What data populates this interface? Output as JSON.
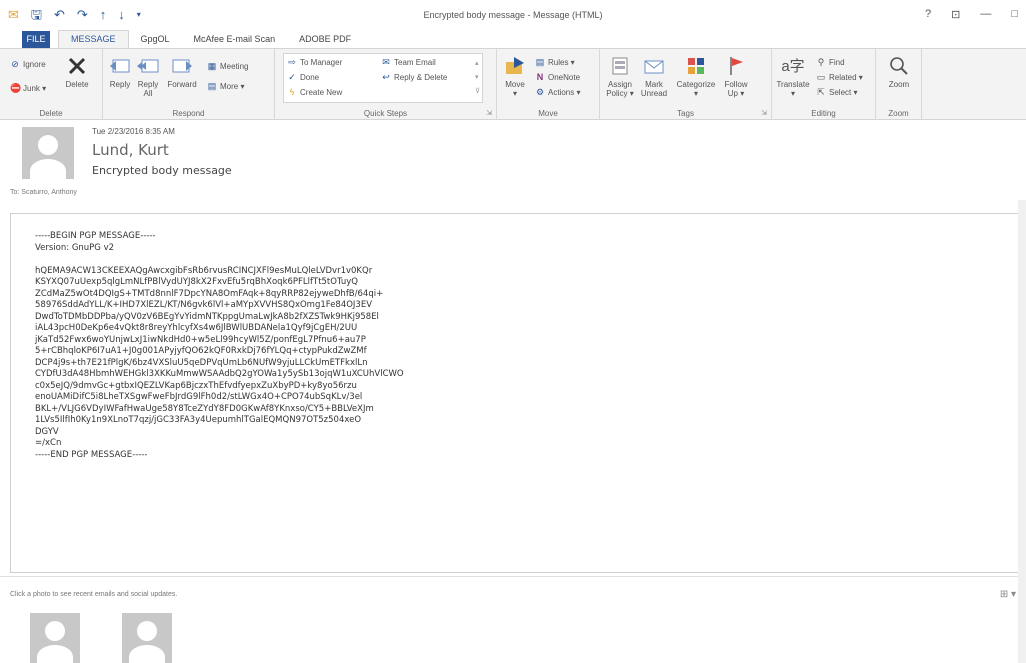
{
  "window": {
    "title": "Encrypted body message - Message (HTML)",
    "controls": [
      "?",
      "⊡",
      "—",
      "□"
    ]
  },
  "tabs": [
    "FILE",
    "MESSAGE",
    "GpgOL",
    "McAfee E-mail Scan",
    "ADOBE PDF"
  ],
  "ribbon": {
    "delete": {
      "ignore": "Ignore",
      "junk": "Junk ▾",
      "delete": "Delete",
      "label": "Delete"
    },
    "respond": {
      "reply": "Reply",
      "reply_all_1": "Reply",
      "reply_all_2": "All",
      "forward": "Forward",
      "meeting": "Meeting",
      "more": "More ▾",
      "label": "Respond"
    },
    "quick_steps": {
      "to_manager": "To Manager",
      "done": "Done",
      "create_new": "Create New",
      "team_email": "Team Email",
      "reply_delete": "Reply & Delete",
      "label": "Quick Steps"
    },
    "move": {
      "move": "Move",
      "move2": "▾",
      "rules": "Rules ▾",
      "onenote": "OneNote",
      "actions": "Actions ▾",
      "label": "Move"
    },
    "tags": {
      "assign1": "Assign",
      "assign2": "Policy ▾",
      "mark1": "Mark",
      "mark2": "Unread",
      "categorize1": "Categorize",
      "categorize2": "▾",
      "follow1": "Follow",
      "follow2": "Up ▾",
      "label": "Tags"
    },
    "editing": {
      "translate1": "Translate",
      "translate2": "▾",
      "find": "Find",
      "related": "Related ▾",
      "select": "Select ▾",
      "label": "Editing"
    },
    "zoom": {
      "zoom": "Zoom",
      "label": "Zoom"
    }
  },
  "message": {
    "date": "Tue 2/23/2016 8:35 AM",
    "from": "Lund, Kurt",
    "subject": "Encrypted body message",
    "to": "To:  Scaturro, Anthony",
    "body_lines": [
      "-----BEGIN PGP MESSAGE-----",
      "Version: GnuPG v2",
      "",
      "hQEMA9ACW13CKEEXAQgAwcxgibFsRb6rvusRCINCJXFl9esMuLQleLVDvr1v0KQr",
      "KSYXQ07uUexp5qlgLmNLfPBlVydUYJ8kX2FxvEfu5rqBhXoqk6PFLlfTt5tOTuyQ",
      "ZCdMaZ5wOt4DQIgS+TMTd8nnlF7DpcYNA8OmFAqk+8qyRRP82ejyweDhfB/64qi+",
      "58976SddAdYLL/K+IHD7XlEZL/KT/N6gvk6lVl+aMYpXVVHS8QxOmg1Fe84OJ3EV",
      "DwdToTDMbDDPba/yQV0zV6BEgYvYidmNTKppgUmaLwJkA8b2fXZSTwk9HKj958El",
      "iAL43pcH0DeKp6e4vQkt8r8reyYhlcyfXs4w6JlBWlUBDANela1Qyf9jCgEH/2UU",
      "jKaTd52Fwx6woYUnjwLxJ1iwNkdHd0+w5eLl99hcyWl5Z/ponfEgL7Pfnu6+au7P",
      "5+rCBhqloKP6I7uA1+J0g001APyjyfQO62kQF0RxkDj76fYLQq+ctypPukdZwZMf",
      "DCP4j9s+th7E21fPlgK/6bz4VXSluU5qeDPVqUmLb6NUfW9yjuLLCkUmETFkxlLn",
      "CYDfU3dA48HbmhWEHGkl3XKKuMmwWSAAdbQ2gYOWa1y5ySb13ojqW1uXCUhVlCWO",
      "c0x5eJQ/9dmvGc+gtbxIQEZLVKap6BjczxThEfvdfyepxZuXbyPD+ky8yo56rzu",
      "enoUAMiDifC5i8LheTXSgwFweFbJrdG9lFh0d2/stLWGx4O+CPO74ubSqKLv/3el",
      "BKL+/VLJG6VDyIWFafHwaUge58Y8TceZYdY8FD0GKwAf8YKnxso/CY5+BBLVeXJm",
      "1LVs5IlfIh0Ky1n9XLnoT7qzj/jGC33FA3y4UepumhlTGalEQMQN97OT5z504xeO",
      "DGYV",
      "=/xCn",
      "-----END PGP MESSAGE-----"
    ]
  },
  "social": {
    "hint": "Click a photo to see recent emails and social updates.",
    "control": "⊞ ▾"
  },
  "colors": {
    "accent": "#2b579a",
    "ribbon_bg": "#f3f3f3",
    "avatar": "#c8c8c8",
    "flag": "#e0483d"
  }
}
